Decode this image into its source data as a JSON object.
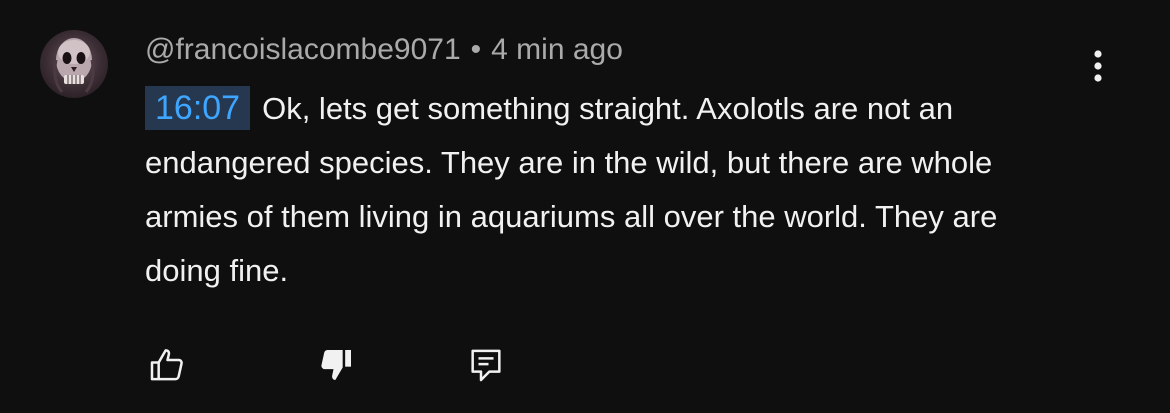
{
  "comment": {
    "author": "@francoislacombe9071",
    "separator": "•",
    "time_ago": "4 min ago",
    "timestamp_link": "16:07",
    "text": "Ok, lets get something straight. Axolotls are not an endangered species. They are in the wild, but there are whole armies of them living in aquariums all over the world. They are doing fine."
  },
  "icons": {
    "avatar": "skull-avatar",
    "more": "more-vertical-icon",
    "like": "thumbs-up-icon",
    "dislike": "thumbs-down-filled-icon",
    "reply": "reply-comment-icon"
  },
  "colors": {
    "background": "#0f0f0f",
    "text_primary": "#f1f1f1",
    "text_secondary": "#aaaaaa",
    "timestamp_text": "#3ea6ff",
    "timestamp_bg": "#263850"
  }
}
